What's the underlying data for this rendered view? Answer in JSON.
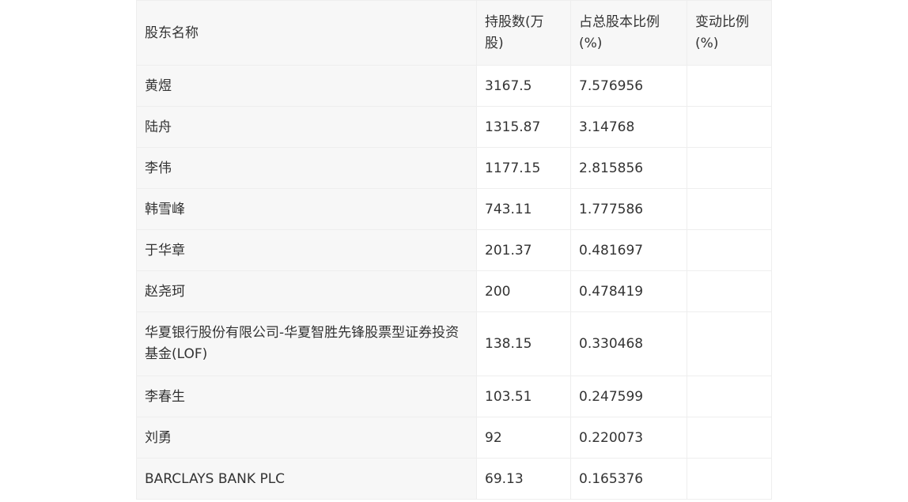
{
  "table": {
    "headers": [
      "股东名称",
      "持股数(万股)",
      "占总股本比例(%)",
      "变动比例(%)"
    ],
    "rows": [
      {
        "name": "黄煜",
        "shares": "3167.5",
        "ratio": "7.576956",
        "change": ""
      },
      {
        "name": "陆舟",
        "shares": "1315.87",
        "ratio": "3.14768",
        "change": ""
      },
      {
        "name": "李伟",
        "shares": "1177.15",
        "ratio": "2.815856",
        "change": ""
      },
      {
        "name": "韩雪峰",
        "shares": "743.11",
        "ratio": "1.777586",
        "change": ""
      },
      {
        "name": "于华章",
        "shares": "201.37",
        "ratio": "0.481697",
        "change": ""
      },
      {
        "name": "赵尧珂",
        "shares": "200",
        "ratio": "0.478419",
        "change": ""
      },
      {
        "name": "华夏银行股份有限公司-华夏智胜先锋股票型证券投资基金(LOF)",
        "shares": "138.15",
        "ratio": "0.330468",
        "change": ""
      },
      {
        "name": "李春生",
        "shares": "103.51",
        "ratio": "0.247599",
        "change": ""
      },
      {
        "name": "刘勇",
        "shares": "92",
        "ratio": "0.220073",
        "change": ""
      },
      {
        "name": "BARCLAYS BANK PLC",
        "shares": "69.13",
        "ratio": "0.165376",
        "change": ""
      }
    ]
  }
}
